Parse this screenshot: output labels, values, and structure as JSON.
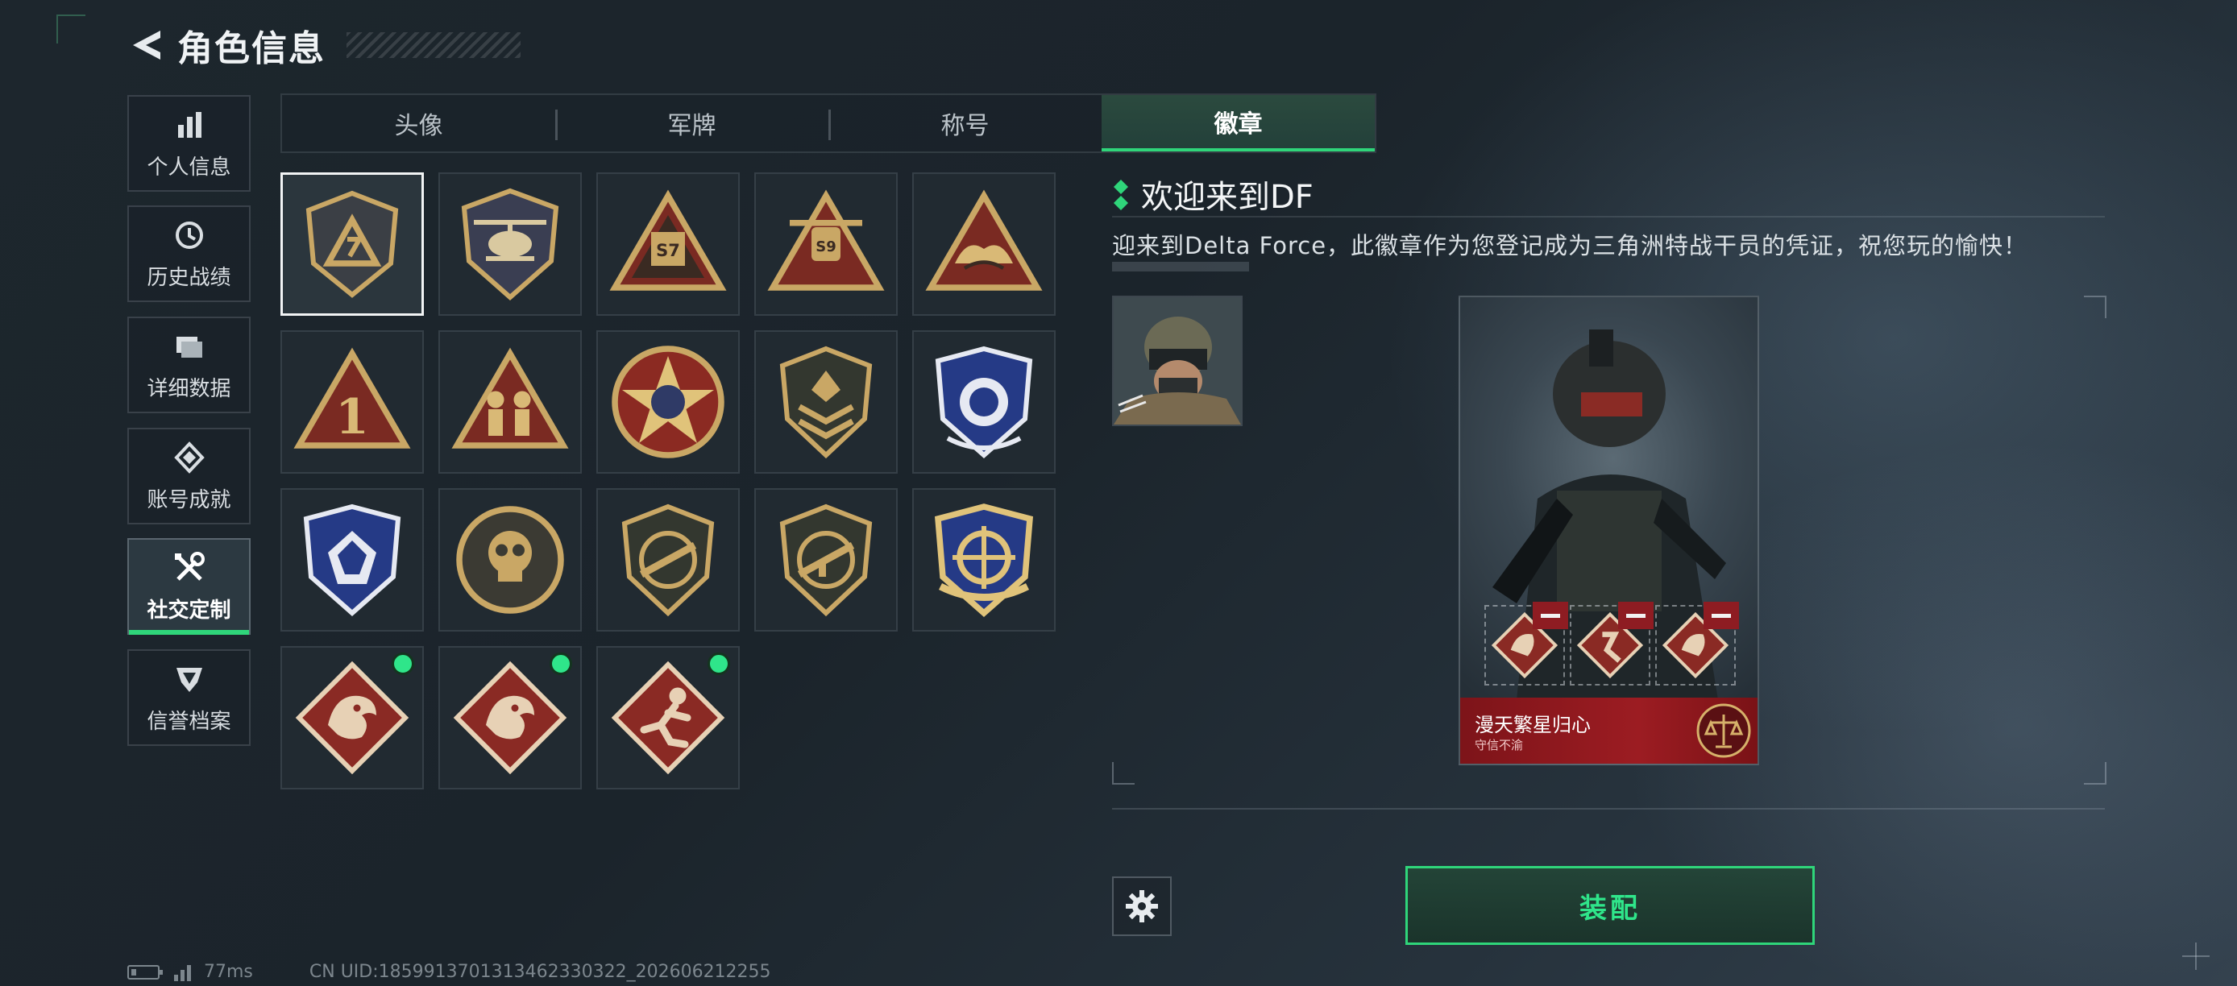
{
  "header": {
    "title": "角色信息"
  },
  "sidebar": {
    "items": [
      {
        "label": "个人信息",
        "icon": "bar-chart-icon",
        "active": false
      },
      {
        "label": "历史战绩",
        "icon": "history-clock-icon",
        "active": false
      },
      {
        "label": "详细数据",
        "icon": "folder-data-icon",
        "active": false
      },
      {
        "label": "账号成就",
        "icon": "achievement-icon",
        "active": false
      },
      {
        "label": "社交定制",
        "icon": "wrench-screwdriver-icon",
        "active": true
      },
      {
        "label": "信誉档案",
        "icon": "reputation-shield-icon",
        "active": false
      }
    ]
  },
  "tabs": [
    {
      "label": "头像",
      "active": false
    },
    {
      "label": "军牌",
      "active": false
    },
    {
      "label": "称号",
      "active": false
    },
    {
      "label": "徽章",
      "active": true
    }
  ],
  "badges": [
    {
      "kind": "shield-dark",
      "selected": true,
      "new": false
    },
    {
      "kind": "helicopter",
      "selected": false,
      "new": false
    },
    {
      "kind": "triangle-s7",
      "selected": false,
      "new": false
    },
    {
      "kind": "triangle-s9",
      "selected": false,
      "new": false
    },
    {
      "kind": "triangle-wings",
      "selected": false,
      "new": false
    },
    {
      "kind": "triangle-1",
      "selected": false,
      "new": false
    },
    {
      "kind": "triangle-soldiers",
      "selected": false,
      "new": false
    },
    {
      "kind": "round-star",
      "selected": false,
      "new": false
    },
    {
      "kind": "shield-chevron",
      "selected": false,
      "new": false
    },
    {
      "kind": "shield-blue-wings",
      "selected": false,
      "new": false
    },
    {
      "kind": "shield-blue-gem",
      "selected": false,
      "new": false
    },
    {
      "kind": "round-skull",
      "selected": false,
      "new": false
    },
    {
      "kind": "shield-rifle",
      "selected": false,
      "new": false
    },
    {
      "kind": "shield-rifle-2",
      "selected": false,
      "new": false
    },
    {
      "kind": "shield-crosshair",
      "selected": false,
      "new": false
    },
    {
      "kind": "diamond-dragon",
      "selected": false,
      "new": true
    },
    {
      "kind": "diamond-dragon-2",
      "selected": false,
      "new": true
    },
    {
      "kind": "diamond-runner",
      "selected": false,
      "new": true
    }
  ],
  "detail": {
    "title": "欢迎来到DF",
    "description": "迎来到Delta Force，此徽章作为您登记成为三角洲特战干员的凭证，祝您玩的愉快！"
  },
  "card": {
    "name": "漫天繁星归心",
    "subtitle": "守信不渝"
  },
  "actions": {
    "equip_label": "装配"
  },
  "status": {
    "ping": "77ms",
    "uid": "CN UID:1859913701313462330322_202606212255"
  },
  "colors": {
    "accent": "#2fd57a",
    "banner_red": "#9c1c22",
    "badge_gold": "#c9a765"
  }
}
